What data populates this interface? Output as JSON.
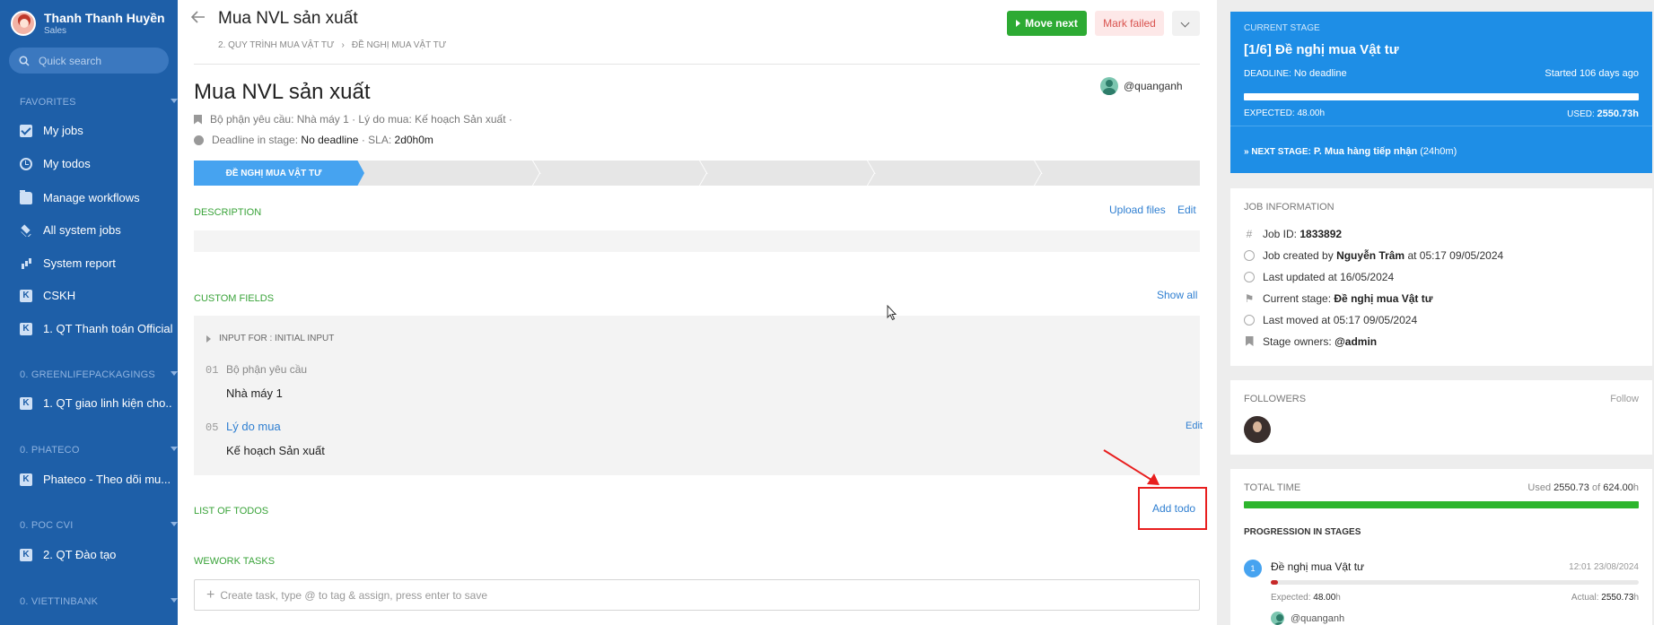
{
  "user": {
    "name": "Thanh Thanh Huyền",
    "role": "Sales"
  },
  "search": {
    "placeholder": "Quick search"
  },
  "sidebar": {
    "sections": [
      {
        "title": "FAVORITES",
        "items": [
          {
            "label": "My jobs",
            "icon": "check-square-icon"
          },
          {
            "label": "My todos",
            "icon": "clock-icon"
          },
          {
            "label": "Manage workflows",
            "icon": "folder-icon"
          },
          {
            "label": "All system jobs",
            "icon": "layers-icon"
          },
          {
            "label": "System report",
            "icon": "bar-chart-icon"
          },
          {
            "label": "CSKH",
            "icon": "workflow-k-icon"
          },
          {
            "label": "1. QT Thanh toán Official",
            "icon": "workflow-k-icon"
          }
        ]
      },
      {
        "title": "0. GREENLIFEPACKAGINGS",
        "items": [
          {
            "label": "1. QT giao linh kiện cho...",
            "icon": "workflow-k-icon"
          }
        ]
      },
      {
        "title": "0. PHATECO",
        "items": [
          {
            "label": "Phateco - Theo dõi mu...",
            "icon": "workflow-k-icon"
          }
        ]
      },
      {
        "title": "0. POC CVI",
        "items": [
          {
            "label": "2. QT Đào tạo",
            "icon": "workflow-k-icon"
          }
        ]
      },
      {
        "title": "0. VIETTINBANK",
        "items": []
      }
    ]
  },
  "header": {
    "title": "Mua NVL sản xuất",
    "breadcrumb": [
      "2. QUY TRÌNH MUA VẬT TƯ",
      "›",
      "ĐỀ NGHỊ MUA VẬT TƯ"
    ],
    "move_next": "Move next",
    "mark_failed": "Mark failed"
  },
  "job": {
    "title": "Mua NVL sản xuất",
    "assignee": "@quanganh",
    "meta_line": "Bộ phận yêu cầu: Nhà máy 1 · Lý do mua: Kế hoạch Sản xuất ·",
    "deadline_label": "Deadline in stage:",
    "deadline_value": "No deadline",
    "sla_label": "· SLA:",
    "sla_value": "2d0h0m",
    "active_stage": "ĐỀ NGHỊ MUA VẬT TƯ"
  },
  "description": {
    "label": "DESCRIPTION",
    "upload": "Upload files",
    "edit": "Edit"
  },
  "custom_fields": {
    "label": "CUSTOM FIELDS",
    "show_all": "Show all",
    "group": "INPUT FOR : INITIAL INPUT",
    "fields": [
      {
        "num": "01",
        "label": "Bộ phận yêu cầu",
        "value": "Nhà máy 1"
      },
      {
        "num": "05",
        "label": "Lý do mua",
        "value": "Kế hoạch Sản xuất",
        "edit": "Edit"
      }
    ]
  },
  "todos": {
    "label": "LIST OF TODOS",
    "add": "Add todo"
  },
  "wework": {
    "label": "WEWORK TASKS",
    "placeholder": "Create task, type @ to tag & assign, press enter to save"
  },
  "current_stage": {
    "label": "CURRENT STAGE",
    "title": "[1/6] Đề nghị mua Vật tư",
    "deadline_label": "DEADLINE:",
    "deadline_value": "No deadline",
    "started": "Started 106 days ago",
    "expected_label": "EXPECTED:",
    "expected_value": "48.00h",
    "used_label": "USED:",
    "used_value": "2550.73h",
    "next_label": "» NEXT STAGE:",
    "next_value": "P. Mua hàng tiếp nhận",
    "next_duration": "(24h0m)"
  },
  "job_info": {
    "label": "JOB INFORMATION",
    "id_label": "Job ID:",
    "id_value": "1833892",
    "created_pre": "Job created by",
    "created_by": "Nguyễn Trâm",
    "created_at": "at 05:17 09/05/2024",
    "updated": "Last updated at 16/05/2024",
    "stage_label": "Current stage:",
    "stage_value": "Đề nghị mua Vật tư",
    "moved": "Last moved at 05:17 09/05/2024",
    "owners_label": "Stage owners:",
    "owners_value": "@admin"
  },
  "followers": {
    "label": "FOLLOWERS",
    "follow": "Follow"
  },
  "total_time": {
    "label": "TOTAL TIME",
    "used_pre": "Used",
    "used_value": "2550.73",
    "of": "of",
    "total": "624.00",
    "unit": "h",
    "progression_label": "PROGRESSION IN STAGES",
    "stage_num": "1",
    "stage_name": "Đề nghị mua Vật tư",
    "stage_date": "12:01 23/08/2024",
    "expected_label": "Expected:",
    "expected_value": "48.00",
    "expected_unit": "h",
    "actual_label": "Actual:",
    "actual_value": "2550.73",
    "actual_unit": "h",
    "owner": "@quanganh"
  },
  "colors": {
    "sidebar": "#1e5fa8",
    "accent": "#1e8ee6",
    "success": "#2daa33",
    "danger": "#d9534f",
    "highlight": "#e81e1e"
  }
}
